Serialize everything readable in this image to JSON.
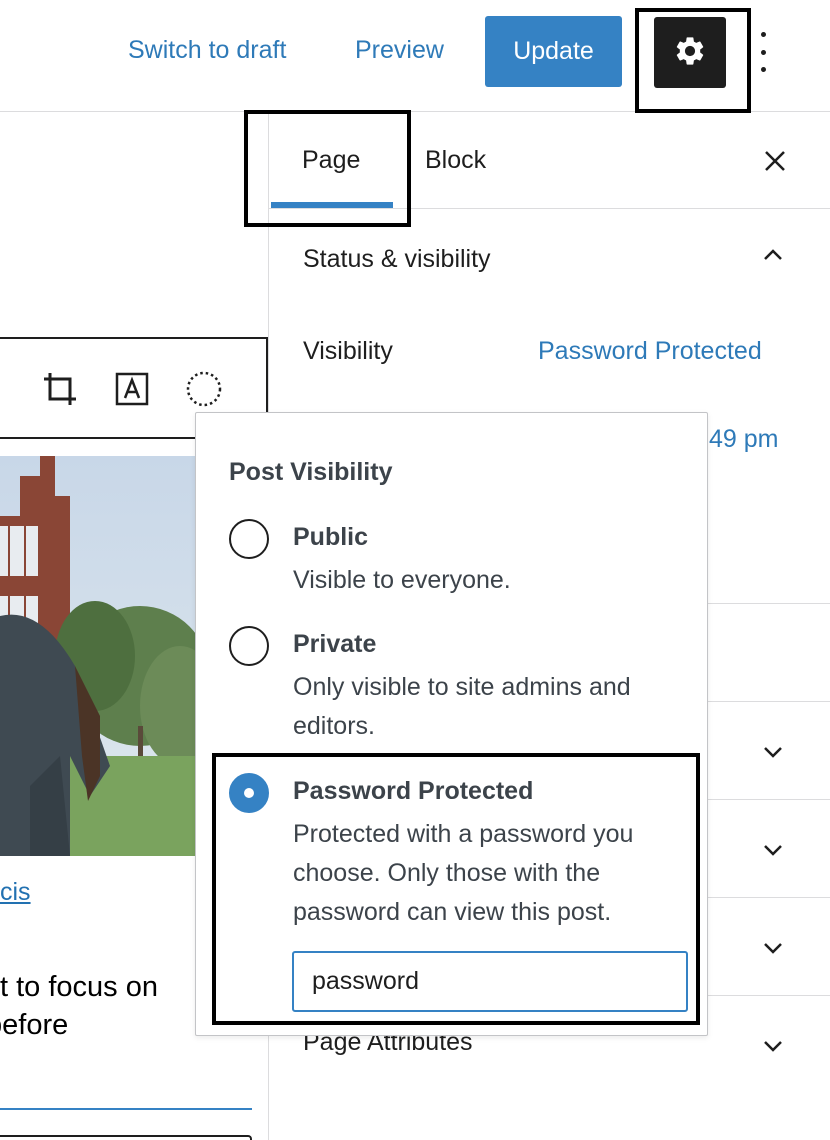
{
  "topbar": {
    "switch_to_draft": "Switch to draft",
    "preview": "Preview",
    "update": "Update"
  },
  "sidebar": {
    "tabs": [
      {
        "label": "Page",
        "active": true
      },
      {
        "label": "Block",
        "active": false
      }
    ],
    "status_panel": {
      "title": "Status & visibility",
      "visibility_label": "Visibility",
      "visibility_value": "Password Protected",
      "publish_value_partial": "49 pm"
    },
    "page_attributes_title": "Page Attributes"
  },
  "popover": {
    "title": "Post Visibility",
    "options": [
      {
        "label": "Public",
        "description": "Visible to everyone.",
        "checked": false
      },
      {
        "label": "Private",
        "description": "Only visible to site admins and editors.",
        "checked": false
      },
      {
        "label": "Password Protected",
        "description": "Protected with a password you choose. Only those with the password can view this post.",
        "checked": true
      }
    ],
    "password_value": "password"
  },
  "editor": {
    "caption_partial": "cis",
    "paragraph_line1": "t to focus on",
    "paragraph_line2": "before"
  },
  "colors": {
    "accent": "#3582c4",
    "link": "#2e7ab8",
    "dark": "#1e1e1e",
    "border": "#dcdcde"
  }
}
